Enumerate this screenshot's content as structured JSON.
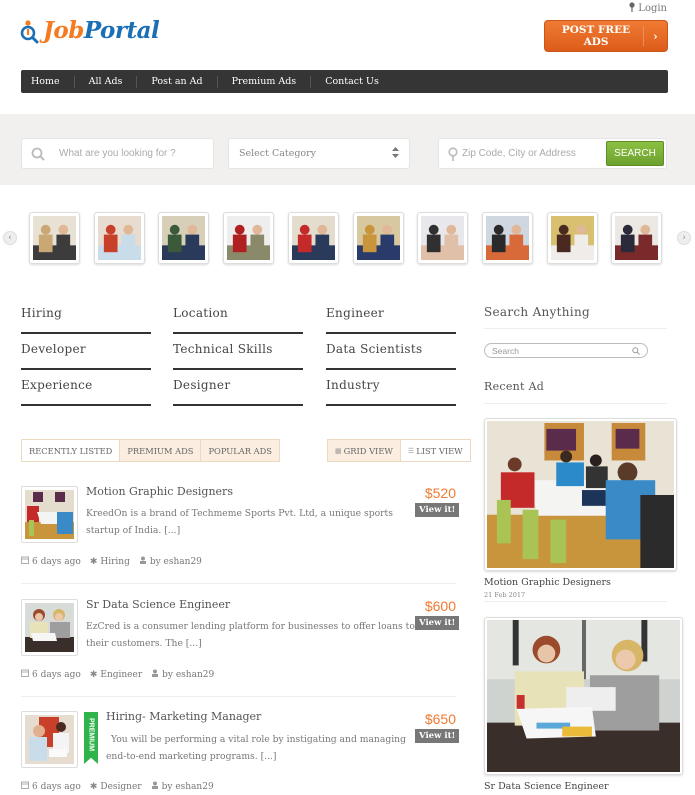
{
  "header": {
    "logo_part1": "Job",
    "logo_part2": "Portal",
    "login_label": "Login",
    "post_button_label": "POST FREE ADS",
    "post_button_arrow": "›",
    "brand_colors": {
      "orange": "#f47b20",
      "blue": "#1b6fb5"
    }
  },
  "nav": {
    "items": [
      {
        "label": "Home"
      },
      {
        "label": "All Ads"
      },
      {
        "label": "Post an Ad"
      },
      {
        "label": "Premium Ads"
      },
      {
        "label": "Contact Us"
      }
    ]
  },
  "search_band": {
    "keyword_placeholder": "What are you looking for ?",
    "category_selected": "Select Category",
    "location_placeholder": "Zip Code, City or Address",
    "search_button_label": "SEARCH"
  },
  "carousel": {
    "prev_label": "‹",
    "next_label": "›",
    "thumbnails": [
      {
        "name": "two-women-meeting"
      },
      {
        "name": "man-woman-discussion"
      },
      {
        "name": "lounge-group"
      },
      {
        "name": "award-presentation"
      },
      {
        "name": "table-group"
      },
      {
        "name": "laptop-women"
      },
      {
        "name": "smiling-woman-office"
      },
      {
        "name": "career-fair-booth"
      },
      {
        "name": "reception-networking"
      },
      {
        "name": "office-hallway-meeting"
      }
    ]
  },
  "categories": [
    {
      "label": "Hiring"
    },
    {
      "label": "Location"
    },
    {
      "label": "Engineer"
    },
    {
      "label": "Developer"
    },
    {
      "label": "Technical Skills"
    },
    {
      "label": "Data Scientists"
    },
    {
      "label": "Experience"
    },
    {
      "label": "Designer"
    },
    {
      "label": "Industry"
    }
  ],
  "sidebar": {
    "search_heading": "Search Anything",
    "search_placeholder": "Search",
    "recent_heading": "Recent Ad",
    "recent_ads": [
      {
        "title": "Motion Graphic Designers",
        "date": "21 Feb 2017"
      },
      {
        "title": "Sr Data Science Engineer"
      }
    ]
  },
  "listing_tabs": {
    "tabs": [
      {
        "label": "RECENTLY LISTED"
      },
      {
        "label": "PREMIUM ADS"
      },
      {
        "label": "POPULAR ADS"
      }
    ],
    "views": [
      {
        "label": "GRID VIEW",
        "icon": "▦"
      },
      {
        "label": "LIST VIEW",
        "icon": "☰"
      }
    ]
  },
  "listings": [
    {
      "title": "Motion Graphic Designers",
      "description": "KreedOn is a brand of Techmeme Sports Pvt. Ltd, a unique sports startup of India. [...]",
      "price": "$520",
      "view_label": "View it!",
      "posted": "6 days ago",
      "category": "Hiring",
      "author": "by eshan29",
      "premium": false
    },
    {
      "title": "Sr Data Science Engineer",
      "description": "EzCred is a consumer lending platform for businesses to offer loans to their customers. The [...]",
      "price": "$600",
      "view_label": "View it!",
      "posted": "6 days ago",
      "category": "Engineer",
      "author": "by eshan29",
      "premium": false
    },
    {
      "title": "Hiring- Marketing Manager",
      "description": "You will be performing a vital role by instigating and managing end-to-end marketing programs. [...]",
      "price": "$650",
      "view_label": "View it!",
      "posted": "6 days ago",
      "category": "Designer",
      "author": "by eshan29",
      "premium": true,
      "premium_label": "PREMIUM"
    }
  ]
}
